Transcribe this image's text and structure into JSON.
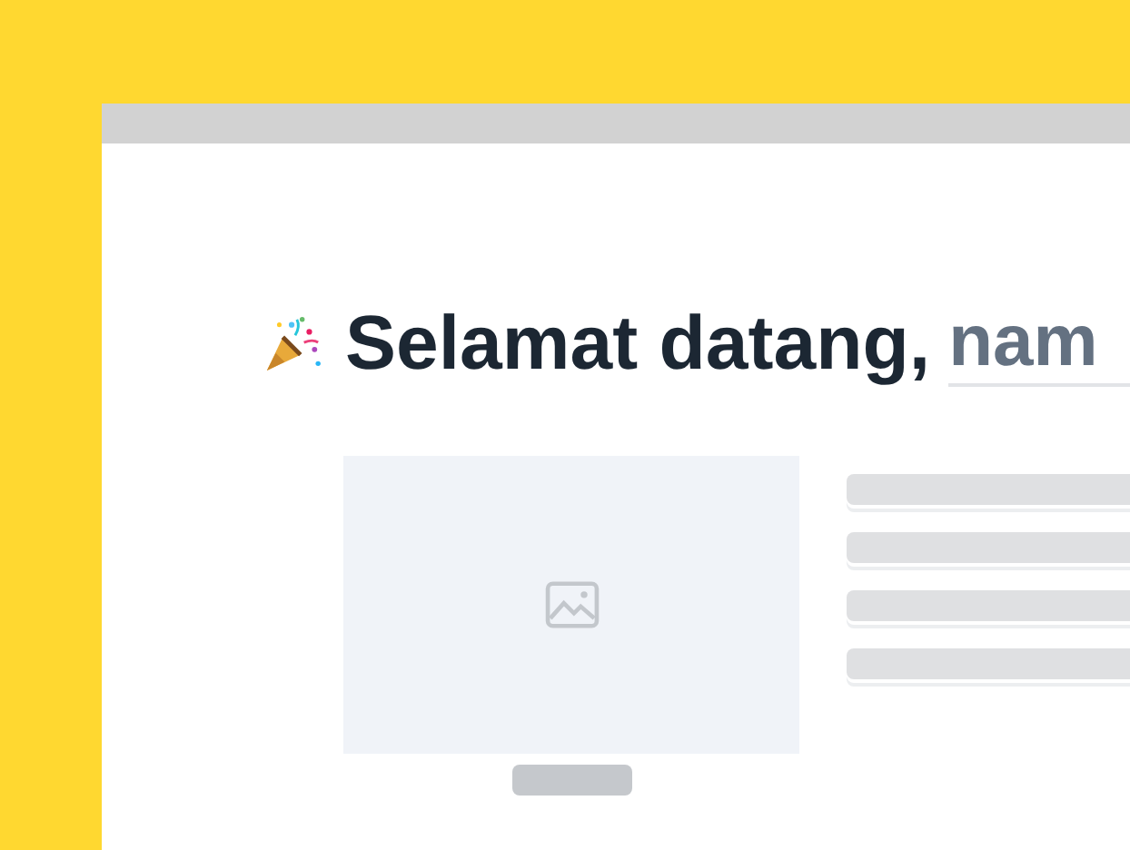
{
  "greeting": {
    "text": "Selamat datang,",
    "name": "nam"
  },
  "text_lines": [
    {
      "kind": "placeholder"
    },
    {
      "kind": "placeholder"
    },
    {
      "kind": "placeholder"
    },
    {
      "kind": "placeholder"
    }
  ]
}
